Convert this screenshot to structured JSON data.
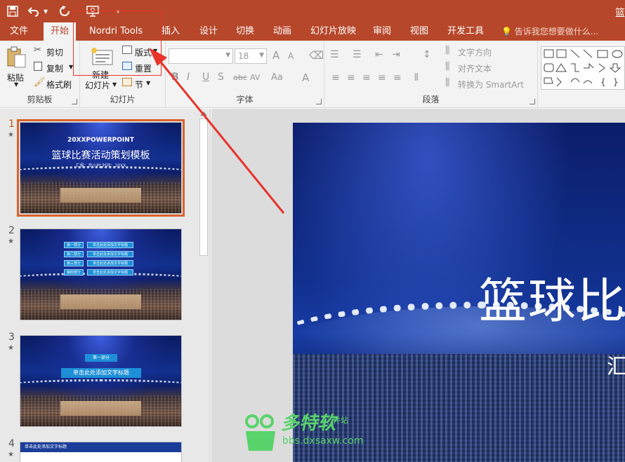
{
  "title_bar": {
    "doc_title": "篮"
  },
  "tabs": [
    {
      "label": "文件",
      "active": false
    },
    {
      "label": "开始",
      "active": true
    },
    {
      "label": "Nordri Tools",
      "active": false
    },
    {
      "label": "插入",
      "active": false
    },
    {
      "label": "设计",
      "active": false
    },
    {
      "label": "切换",
      "active": false
    },
    {
      "label": "动画",
      "active": false
    },
    {
      "label": "幻灯片放映",
      "active": false
    },
    {
      "label": "审阅",
      "active": false
    },
    {
      "label": "视图",
      "active": false
    },
    {
      "label": "开发工具",
      "active": false
    }
  ],
  "tell_me": "告诉我您想要做什么...",
  "ribbon": {
    "clipboard": {
      "paste": "粘贴",
      "cut": "剪切",
      "copy": "复制",
      "format_painter": "格式刷",
      "label": "剪贴板"
    },
    "slides": {
      "new_slide_line1": "新建",
      "new_slide_line2": "幻灯片",
      "layout": "版式",
      "reset": "重置",
      "section": "节",
      "label": "幻灯片"
    },
    "font": {
      "font_size": "18",
      "bold": "B",
      "italic": "I",
      "underline": "U",
      "shadow": "S",
      "strike": "abc",
      "spacing": "AV",
      "case": "Aa",
      "color": "A",
      "grow": "A",
      "shrink": "A",
      "label": "字体"
    },
    "paragraph": {
      "text_direction": "文字方向",
      "align_text": "对齐文本",
      "smartart": "转换为 SmartArt",
      "label": "段落"
    }
  },
  "thumbnails": {
    "slide1": {
      "num": "1",
      "star": "★",
      "line1": "20XXPOWERPOINT",
      "line2": "篮球比赛活动策划模板",
      "line3": "汇报：步小时 时间：20XX"
    },
    "slide2": {
      "num": "2",
      "star": "★",
      "toc": [
        {
          "part": "第一部分",
          "text": "单击此处添加文字标题"
        },
        {
          "part": "第二部分",
          "text": "单击此处添加文字标题"
        },
        {
          "part": "第三部分",
          "text": "单击此处添加文字标题"
        },
        {
          "part": "第四部分",
          "text": "单击此处添加文字标题"
        }
      ]
    },
    "slide3": {
      "num": "3",
      "star": "★",
      "part": "第一部分",
      "title": "单击此处添加文字标题"
    },
    "slide4": {
      "num": "4",
      "star": "★",
      "header": "单击此处添加文字标题"
    }
  },
  "main_slide": {
    "title_visible": "篮球比",
    "subtitle_visible": "汇"
  },
  "watermark": {
    "brand": "多特软",
    "tag": "件站",
    "url": "bbs.dxsaxw.com"
  },
  "colors": {
    "accent": "#b7472a",
    "selected_outline": "#d8622f",
    "annotation": "#e8332a",
    "watermark": "#59d36b"
  }
}
